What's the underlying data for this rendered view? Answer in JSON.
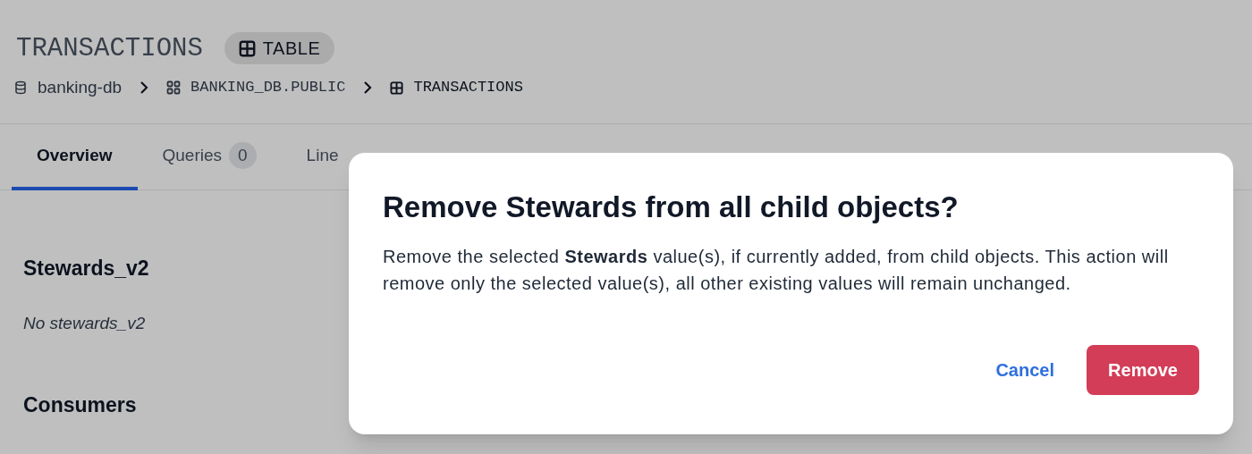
{
  "header": {
    "title": "TRANSACTIONS",
    "type_badge": "TABLE"
  },
  "breadcrumb": [
    {
      "kind": "database",
      "label": "banking-db"
    },
    {
      "kind": "schema",
      "label": "BANKING_DB.PUBLIC"
    },
    {
      "kind": "table",
      "label": "TRANSACTIONS"
    }
  ],
  "tabs": [
    {
      "label": "Overview",
      "selected": true
    },
    {
      "label": "Queries",
      "count": "0",
      "selected": false
    },
    {
      "label": "Line",
      "selected": false
    }
  ],
  "sections": [
    {
      "title": "Stewards_v2",
      "empty_text": "No stewards_v2"
    },
    {
      "title": "Consumers"
    }
  ],
  "dialog": {
    "title": "Remove Stewards from all child objects?",
    "message": "Remove the selected **Stewards** value(s), if currently added, from child objects. This action will remove only the selected value(s), all other existing values will remain unchanged.",
    "cancel": "Cancel",
    "confirm": "Remove"
  }
}
